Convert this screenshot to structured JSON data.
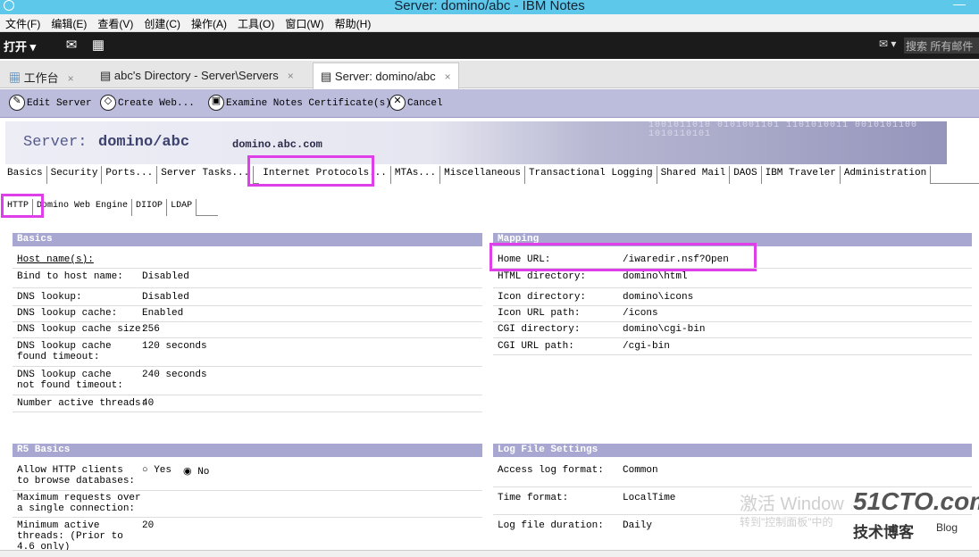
{
  "window": {
    "title": "Server: domino/abc - IBM Notes"
  },
  "menu": [
    "文件(F)",
    "编辑(E)",
    "查看(V)",
    "创建(C)",
    "操作(A)",
    "工具(O)",
    "窗口(W)",
    "帮助(H)"
  ],
  "toolbar": {
    "open_label": "打开",
    "search_placeholder": "搜索 所有邮件"
  },
  "window_tabs": [
    {
      "label": "工作台",
      "close": "×"
    },
    {
      "label": "abc's Directory - Server\\Servers",
      "close": "×"
    },
    {
      "label": "Server: domino/abc",
      "close": "×"
    }
  ],
  "actions": [
    {
      "label": "Edit Server"
    },
    {
      "label": "Create Web..."
    },
    {
      "label": "Examine Notes Certificate(s)"
    },
    {
      "label": "Cancel"
    }
  ],
  "banner": {
    "label": "Server:",
    "name": "domino/abc",
    "host": "domino.abc.com",
    "bits": "1001011010 0101001101 1101010011 0010101100 1010110101"
  },
  "main_tabs": [
    "Basics",
    "Security",
    "Ports...",
    "Server Tasks...",
    "Internet Protocols...",
    "MTAs...",
    "Miscellaneous",
    "Transactional Logging",
    "Shared Mail",
    "DAOS",
    "IBM Traveler",
    "Administration"
  ],
  "sub_tabs": [
    "HTTP",
    "Domino Web Engine",
    "DIIOP",
    "LDAP"
  ],
  "basics": {
    "title": "Basics",
    "host_names": "Host name(s):",
    "rows": [
      {
        "k": "Bind to host name:",
        "v": "Disabled"
      },
      {
        "k": "DNS lookup:",
        "v": "Disabled"
      },
      {
        "k": "DNS lookup cache:",
        "v": "Enabled"
      },
      {
        "k": "DNS lookup cache size:",
        "v": "256"
      },
      {
        "k": "DNS lookup cache found timeout:",
        "v": "120 seconds"
      },
      {
        "k": "DNS lookup cache not found timeout:",
        "v": "240 seconds"
      },
      {
        "k": "Number active threads:",
        "v": "40"
      }
    ]
  },
  "mapping": {
    "title": "Mapping",
    "rows": [
      {
        "k": "Home URL:",
        "v": "/iwaredir.nsf?Open"
      },
      {
        "k": "HTML directory:",
        "v": "domino\\html"
      },
      {
        "k": "Icon directory:",
        "v": "domino\\icons"
      },
      {
        "k": "Icon URL path:",
        "v": "/icons"
      },
      {
        "k": "CGI directory:",
        "v": "domino\\cgi-bin"
      },
      {
        "k": "CGI URL path:",
        "v": "/cgi-bin"
      }
    ]
  },
  "r5basics": {
    "title": "R5 Basics",
    "allow_label": "Allow HTTP clients to browse databases:",
    "yes": "Yes",
    "no": "No",
    "selected": "No",
    "rows": [
      {
        "k": "Maximum requests over a single connection:",
        "v": ""
      },
      {
        "k": "Minimum active threads: (Prior to 4.6 only)",
        "v": "20"
      }
    ]
  },
  "logfile": {
    "title": "Log File Settings",
    "rows": [
      {
        "k": "Access log format:",
        "v": "Common"
      },
      {
        "k": "Time format:",
        "v": "LocalTime"
      },
      {
        "k": "Log file duration:",
        "v": "Daily"
      }
    ]
  },
  "watermark": {
    "line1": "激活 Window",
    "line2": "转到\"控制面板\"中的",
    "logo": "51CTO.com",
    "sub": "技术博客",
    "blog": "Blog"
  }
}
